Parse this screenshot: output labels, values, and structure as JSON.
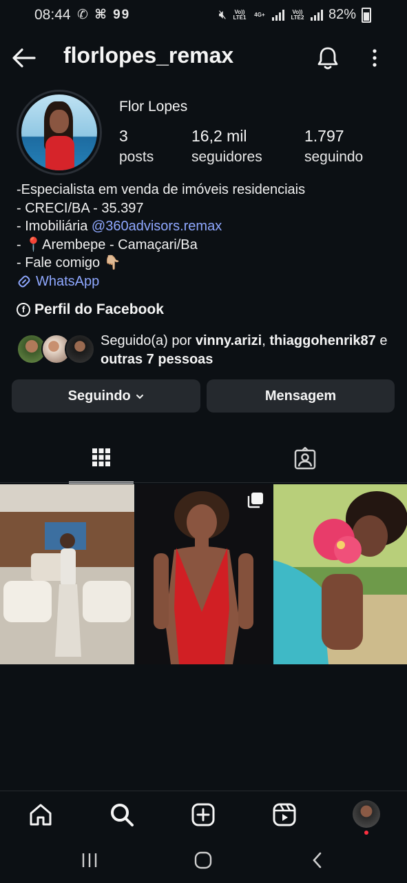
{
  "status_bar": {
    "time": "08:44",
    "left_icons": "✆ ⌘ 99",
    "sim1": "Vo)) LTE1",
    "sim2": "Vo)) LTE2",
    "net": "4G+",
    "battery": "82%"
  },
  "header": {
    "username": "florlopes_remax"
  },
  "profile": {
    "name": "Flor Lopes",
    "stats": [
      {
        "value": "3",
        "label": "posts"
      },
      {
        "value": "16,2 mil",
        "label": "seguidores"
      },
      {
        "value": "1.797",
        "label": "seguindo"
      }
    ],
    "bio": {
      "line1": "-Especialista em venda de imóveis residenciais",
      "line2": "- CRECI/BA - 35.397",
      "line3_prefix": "- Imobiliária ",
      "line3_mention": "@360advisors.remax",
      "line4_prefix": "- ",
      "line4_pin": "📍",
      "line4_text": "Arembepe - Camaçari/Ba",
      "line5_text": "- Fale comigo ",
      "line5_emoji": "👇🏼",
      "link": "WhatsApp"
    },
    "facebook_link": "Perfil do Facebook",
    "followed_by": {
      "prefix": "Seguido(a) por ",
      "user1": "vinny.arizi",
      "sep": ", ",
      "user2": "thiaggohenrik87",
      "mid": " e ",
      "others": "outras 7 pessoas"
    }
  },
  "actions": {
    "following_label": "Seguindo",
    "message_label": "Mensagem"
  },
  "tabs": [
    "grid-tab",
    "tagged-tab"
  ],
  "colors": {
    "background": "#0c1014",
    "button": "#25292e",
    "link": "#8fa8ff",
    "notification_dot": "#ff3040"
  }
}
